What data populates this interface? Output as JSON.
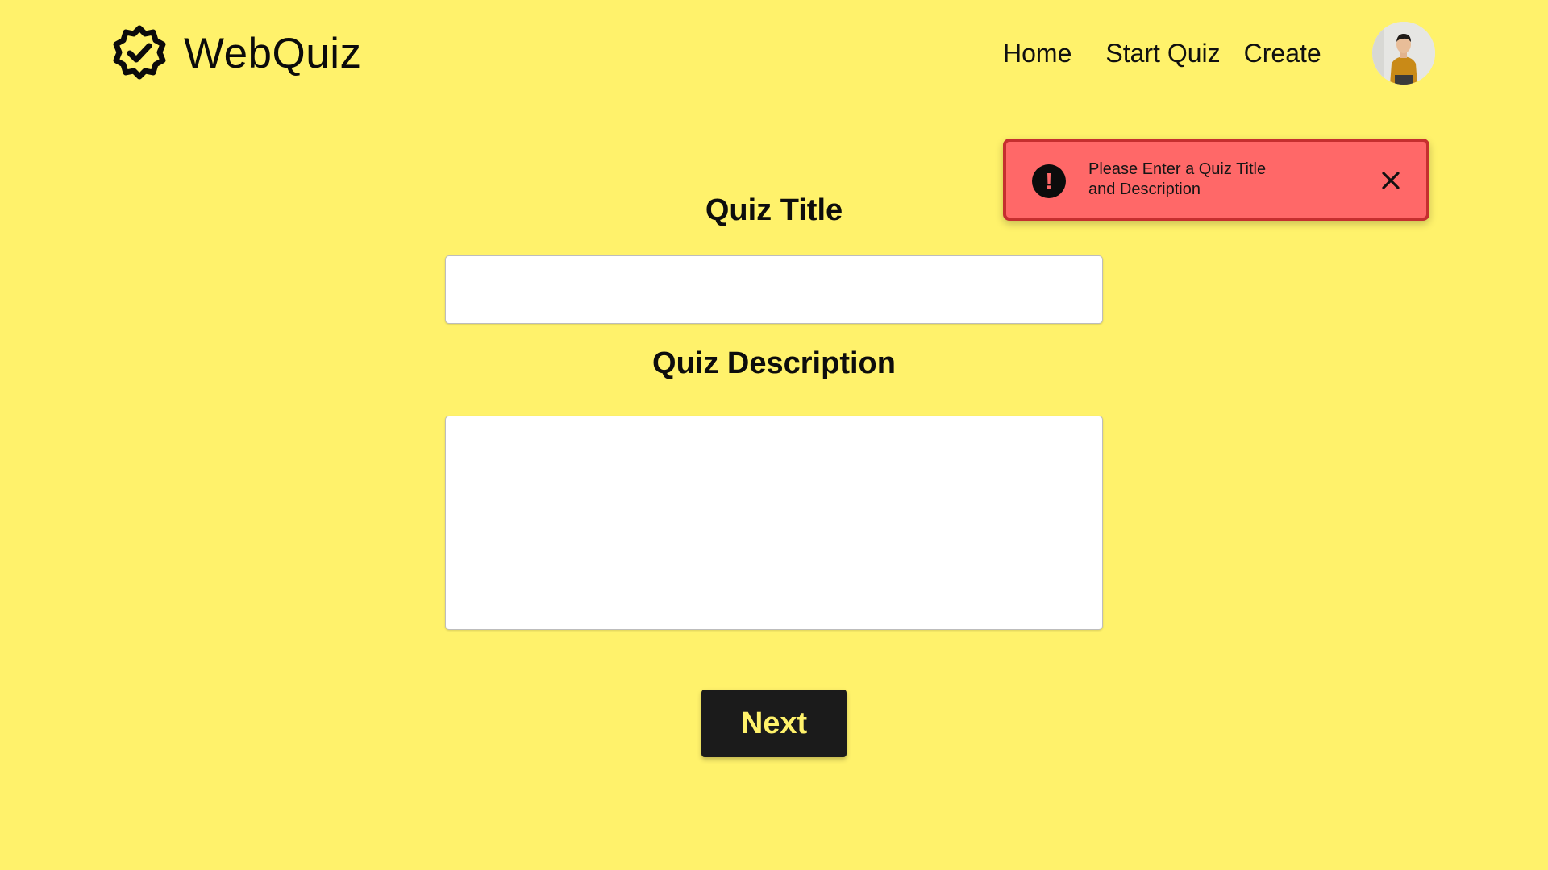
{
  "app": {
    "title": "WebQuiz",
    "logo_icon": "verified-badge-icon"
  },
  "nav": {
    "items": [
      {
        "label": "Home"
      },
      {
        "label": "Start Quiz"
      },
      {
        "label": "Create"
      }
    ],
    "avatar_icon": "user-avatar"
  },
  "toast": {
    "icon": "error-icon",
    "message_line1": "Please Enter a Quiz Title",
    "message_line2": "and Description",
    "close_icon": "close-icon"
  },
  "form": {
    "title_label": "Quiz Title",
    "title_value": "",
    "description_label": "Quiz Description",
    "description_value": "",
    "next_label": "Next"
  },
  "colors": {
    "background": "#fff26b",
    "toast_bg": "#ff6868",
    "toast_border": "#c52f2f",
    "button_bg": "#1b1b1b",
    "button_text": "#fff26b"
  }
}
